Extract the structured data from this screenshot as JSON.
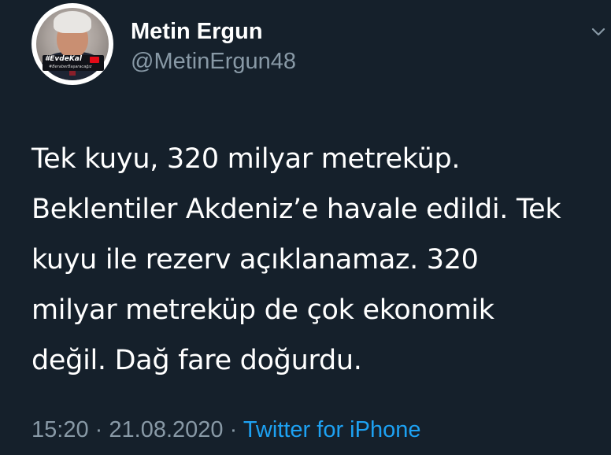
{
  "user": {
    "display_name": "Metin Ergun",
    "handle": "@MetinErgun48",
    "avatar": {
      "badge_text": "#EvdeKal",
      "badge_subtext": "#BeraberBaşaracağız",
      "flag_color": "#e30a17"
    }
  },
  "tweet": {
    "lines": [
      "Tek kuyu, 320 milyar metreküp.",
      "Beklentiler Akdeniz’e havale edildi. Tek",
      "kuyu ile rezerv açıklanamaz. 320",
      "milyar metreküp de çok ekonomik",
      "değil. Dağ fare doğurdu."
    ]
  },
  "meta": {
    "time": "15:20",
    "separator": "·",
    "date": "21.08.2020",
    "source": "Twitter for iPhone"
  },
  "icons": {
    "more": "chevron-down-icon"
  },
  "colors": {
    "background": "#15202b",
    "text_primary": "#ffffff",
    "text_secondary": "#8899a6",
    "link": "#1da1f2"
  }
}
